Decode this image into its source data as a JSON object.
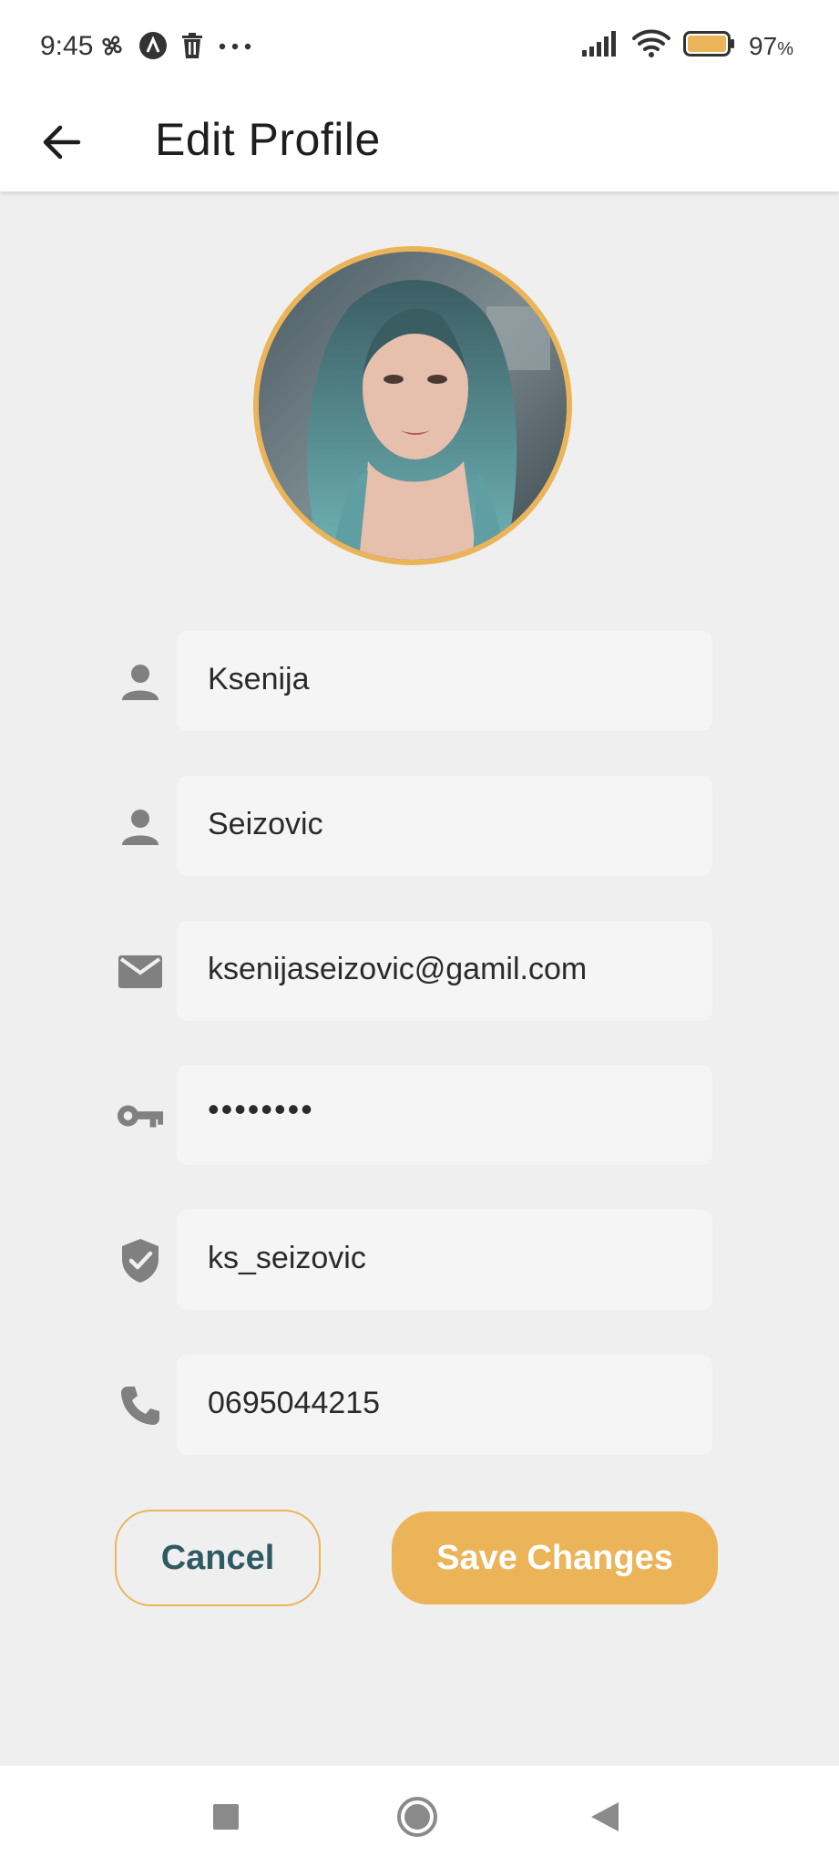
{
  "status_bar": {
    "time": "9:45",
    "battery_level": "97",
    "battery_unit": "%",
    "icons_left": [
      "pinwheel-icon",
      "a-circle-icon",
      "trash-icon",
      "more-dots-icon"
    ],
    "icons_right": [
      "signal-icon",
      "wifi-icon",
      "battery-icon"
    ]
  },
  "app_bar": {
    "title": "Edit Profile"
  },
  "avatar": {
    "border_color": "#ebb458"
  },
  "form": {
    "fields": [
      {
        "icon": "person-icon",
        "value": "Ksenija"
      },
      {
        "icon": "person-icon",
        "value": "Seizovic"
      },
      {
        "icon": "email-icon",
        "value": "ksenijaseizovic@gamil.com"
      },
      {
        "icon": "key-icon",
        "value": "••••••••"
      },
      {
        "icon": "shield-check-icon",
        "value": "ks_seizovic"
      },
      {
        "icon": "phone-icon",
        "value": "0695044215"
      }
    ]
  },
  "actions": {
    "cancel_label": "Cancel",
    "save_label": "Save Changes"
  },
  "colors": {
    "accent": "#ebb458",
    "cancel_text": "#2f5a63",
    "background": "#efefef",
    "field_background": "#f5f5f5",
    "icon_gray": "#808080"
  }
}
